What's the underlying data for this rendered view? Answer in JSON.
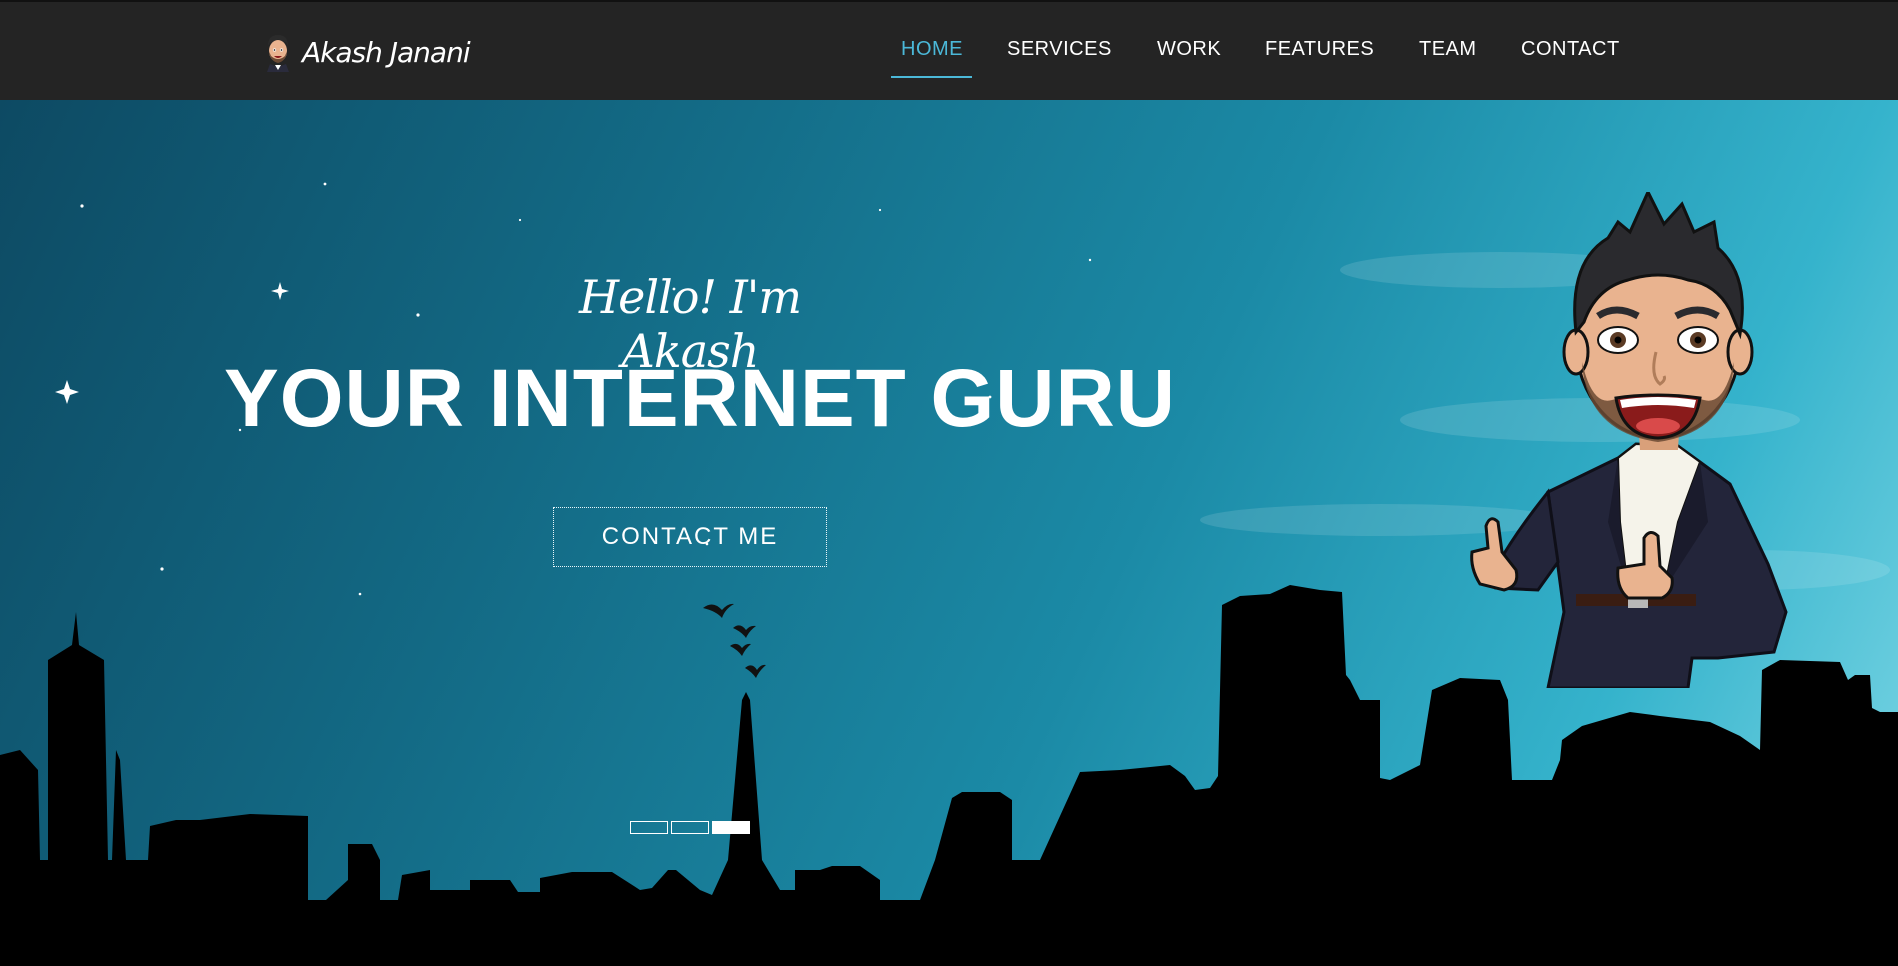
{
  "navbar": {
    "brand_name": "Akash Janani",
    "links": [
      {
        "label": "HOME",
        "active": true
      },
      {
        "label": "SERVICES",
        "active": false
      },
      {
        "label": "WORK",
        "active": false
      },
      {
        "label": "FEATURES",
        "active": false
      },
      {
        "label": "TEAM",
        "active": false
      },
      {
        "label": "CONTACT",
        "active": false
      }
    ]
  },
  "hero": {
    "greeting": "Hello! I'm Akash",
    "headline": "YOUR INTERNET GURU",
    "cta_label": "CONTACT ME",
    "slides": {
      "count": 3,
      "active_index": 2
    }
  },
  "colors": {
    "navbar_bg": "#242424",
    "accent": "#4bb8d8",
    "sky_dark": "#0d4a63",
    "sky_light": "#7fd8e6",
    "text": "#ffffff"
  },
  "icons": {
    "brand": "bitmoji-avatar-icon",
    "mascot": "bitmoji-thumbs-up-illustration"
  }
}
